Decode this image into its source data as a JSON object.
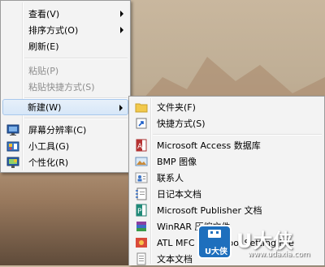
{
  "context_menu": {
    "items": [
      {
        "label": "查看(V)",
        "has_submenu": true,
        "enabled": true
      },
      {
        "label": "排序方式(O)",
        "has_submenu": true,
        "enabled": true
      },
      {
        "label": "刷新(E)",
        "has_submenu": false,
        "enabled": true
      },
      {
        "label": "粘贴(P)",
        "has_submenu": false,
        "enabled": false
      },
      {
        "label": "粘贴快捷方式(S)",
        "has_submenu": false,
        "enabled": false
      },
      {
        "label": "新建(W)",
        "has_submenu": true,
        "enabled": true,
        "highlighted": true
      },
      {
        "label": "屏幕分辨率(C)",
        "icon": "display-icon",
        "enabled": true
      },
      {
        "label": "小工具(G)",
        "icon": "gadgets-icon",
        "enabled": true
      },
      {
        "label": "个性化(R)",
        "icon": "personalize-icon",
        "enabled": true
      }
    ]
  },
  "new_submenu": {
    "items": [
      {
        "label": "文件夹(F)",
        "icon": "folder-icon"
      },
      {
        "label": "快捷方式(S)",
        "icon": "shortcut-icon"
      },
      {
        "label": "Microsoft Access 数据库",
        "icon": "access-icon"
      },
      {
        "label": "BMP 图像",
        "icon": "bitmap-icon"
      },
      {
        "label": "联系人",
        "icon": "contact-icon"
      },
      {
        "label": "日记本文档",
        "icon": "journal-icon"
      },
      {
        "label": "Microsoft Publisher 文档",
        "icon": "publisher-icon"
      },
      {
        "label": "WinRAR 压缩文件",
        "icon": "winrar-icon"
      },
      {
        "label": "ATL MFC Trace Tool Setting File",
        "icon": "atl-settings-icon"
      },
      {
        "label": "文本文档",
        "icon": "text-document-icon"
      }
    ]
  },
  "watermark": {
    "logo_text": "U大侠",
    "brand": "U大侠",
    "url": "www.udaxia.com"
  },
  "colors": {
    "menu_background": "#f3f3f3",
    "highlight_border": "#a8c8ec",
    "disabled_text": "#8d8d8d",
    "watermark_blue": "#1e6fbd"
  }
}
